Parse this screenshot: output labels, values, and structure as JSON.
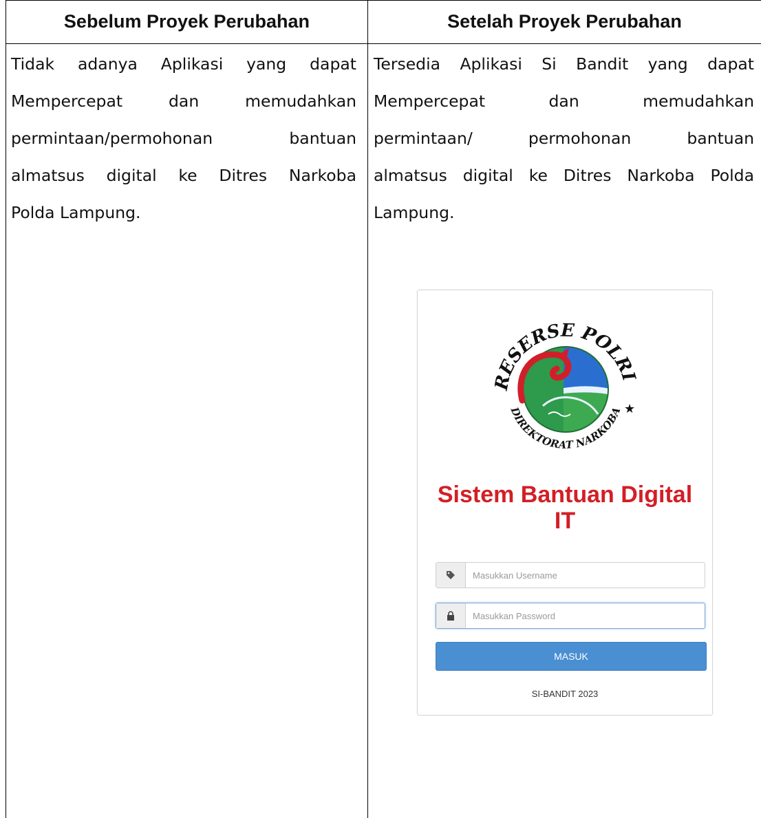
{
  "table": {
    "left_header": "Sebelum Proyek Perubahan",
    "right_header": "Setelah Proyek Perubahan",
    "left_lines": [
      [
        "Tidak",
        "adanya",
        "Aplikasi",
        "yang",
        "dapat"
      ],
      [
        "Mempercepat",
        "dan",
        "memudahkan"
      ],
      [
        "permintaan/permohonan",
        "bantuan"
      ],
      [
        "almatsus",
        "digital",
        "ke",
        "Ditres",
        "Narkoba"
      ],
      [
        "Polda Lampung."
      ]
    ],
    "right_lines": [
      [
        "Tersedia",
        "Aplikasi",
        "Si",
        "Bandit",
        "yang",
        "dapat"
      ],
      [
        "Mempercepat",
        "dan",
        "memudahkan"
      ],
      [
        "permintaan/",
        "permohonan",
        "bantuan"
      ],
      [
        "almatsus",
        "digital",
        "ke",
        "Ditres",
        "Narkoba",
        "Polda"
      ],
      [
        "Lampung."
      ]
    ]
  },
  "login": {
    "logo_top_text": "RESERSE POLRI",
    "logo_bottom_text": "DIREKTORAT NARKOBA",
    "title": "Sistem Bantuan Digital IT",
    "username_placeholder": "Masukkan Username",
    "password_placeholder": "Masukkan Password",
    "submit_label": "MASUK",
    "footer": "SI-BANDIT 2023",
    "title_color": "#d21f26",
    "button_color": "#4a8fd1"
  }
}
